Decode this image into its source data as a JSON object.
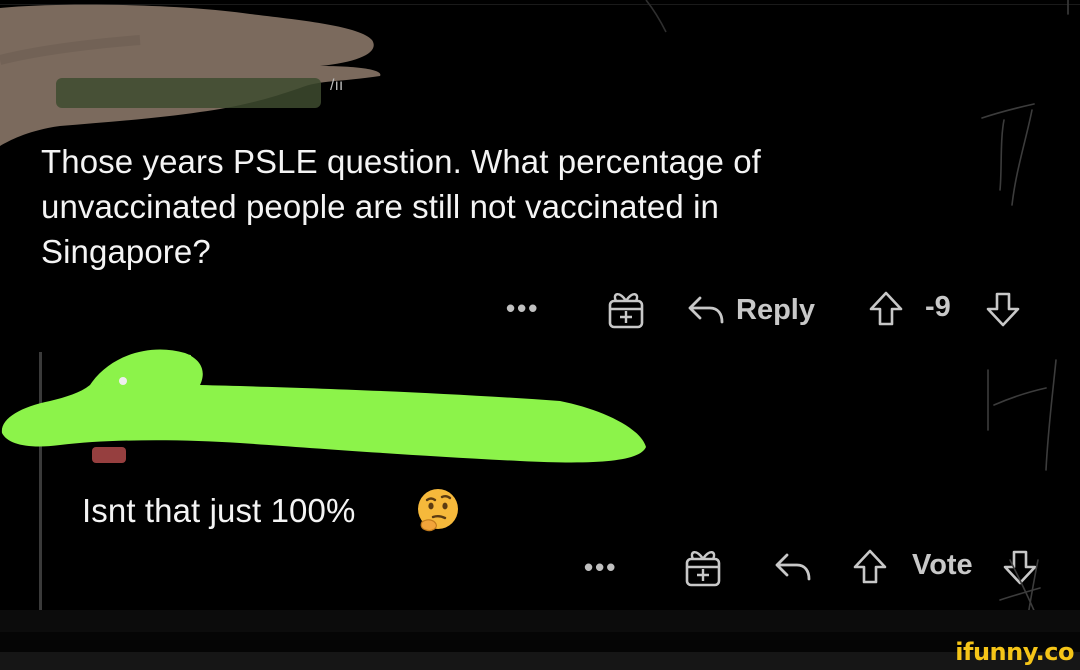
{
  "comment1": {
    "text_line1": "Those years PSLE question. What percentage of",
    "text_line2": "unvaccinated people are still not vaccinated in",
    "text_line3": "Singapore?",
    "actions": {
      "more": "•••",
      "reply_label": "Reply",
      "score": "-9"
    }
  },
  "comment2": {
    "text": "Isnt that just 100%",
    "emoji_icon": "thinking-face-icon",
    "actions": {
      "more": "•••",
      "vote_label": "Vote"
    }
  },
  "watermark": "ifunny.co",
  "colors": {
    "background": "#000000",
    "text": "#f4f4f4",
    "action_text": "#c8c8c8",
    "brown_scribble": "#7a6a5c",
    "green_scribble": "#8cf34a",
    "watermark": "#f5c518"
  }
}
